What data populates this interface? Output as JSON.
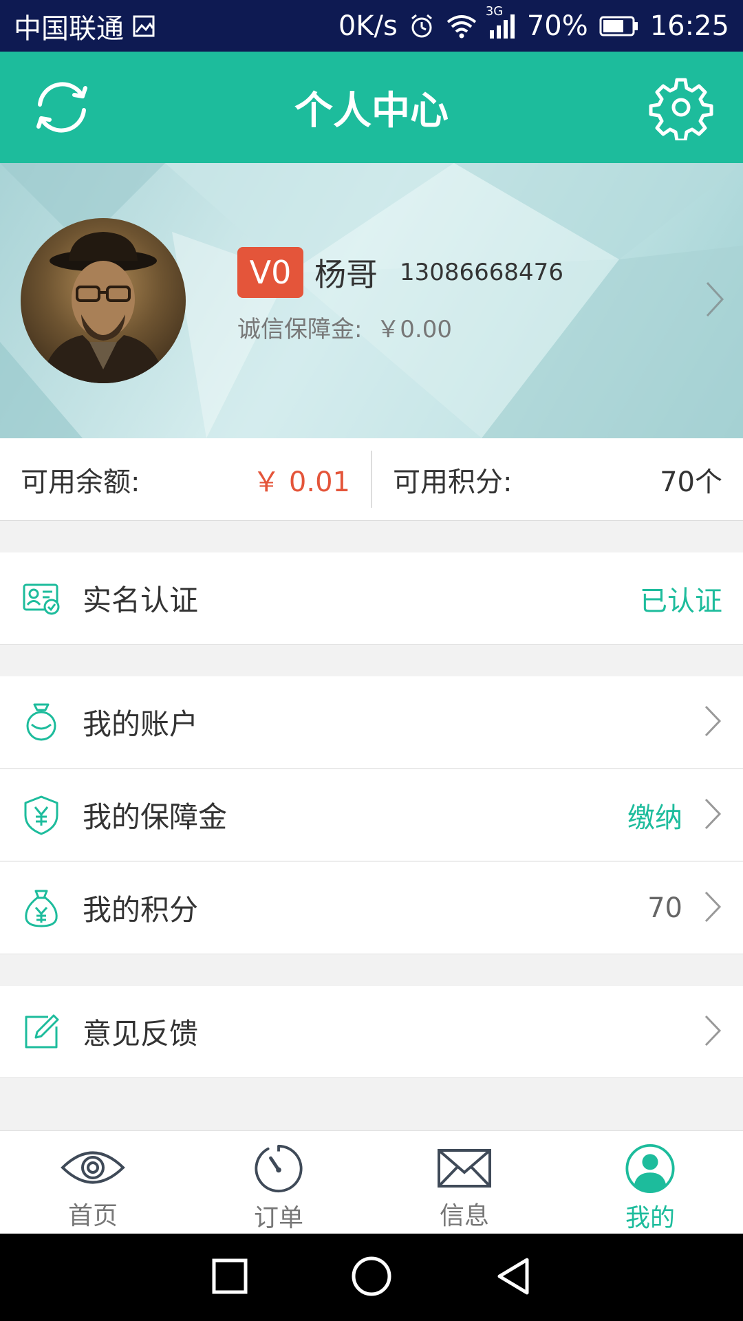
{
  "status_bar": {
    "carrier": "中国联通",
    "speed": "0K/s",
    "network": "3G",
    "battery": "70%",
    "time": "16:25"
  },
  "header": {
    "title": "个人中心"
  },
  "profile": {
    "level": "V0",
    "name": "杨哥",
    "phone": "13086668476",
    "deposit_label": "诚信保障金:",
    "deposit_value": "￥0.00"
  },
  "balance": {
    "available_label": "可用余额:",
    "available_value": "￥ 0.01",
    "points_label": "可用积分:",
    "points_value": "70个"
  },
  "menu": {
    "verify": {
      "label": "实名认证",
      "value": "已认证"
    },
    "account": {
      "label": "我的账户"
    },
    "guarantee": {
      "label": "我的保障金",
      "value": "缴纳"
    },
    "points": {
      "label": "我的积分",
      "value": "70"
    },
    "feedback": {
      "label": "意见反馈"
    }
  },
  "tabs": [
    {
      "label": "首页",
      "icon": "eye-icon"
    },
    {
      "label": "订单",
      "icon": "timer-icon"
    },
    {
      "label": "信息",
      "icon": "envelope-icon"
    },
    {
      "label": "我的",
      "icon": "user-icon"
    }
  ],
  "colors": {
    "brand": "#1dbc9c",
    "accent_red": "#e4553a",
    "status_bar": "#0e1a52",
    "inactive_icon": "#3f4a58"
  }
}
